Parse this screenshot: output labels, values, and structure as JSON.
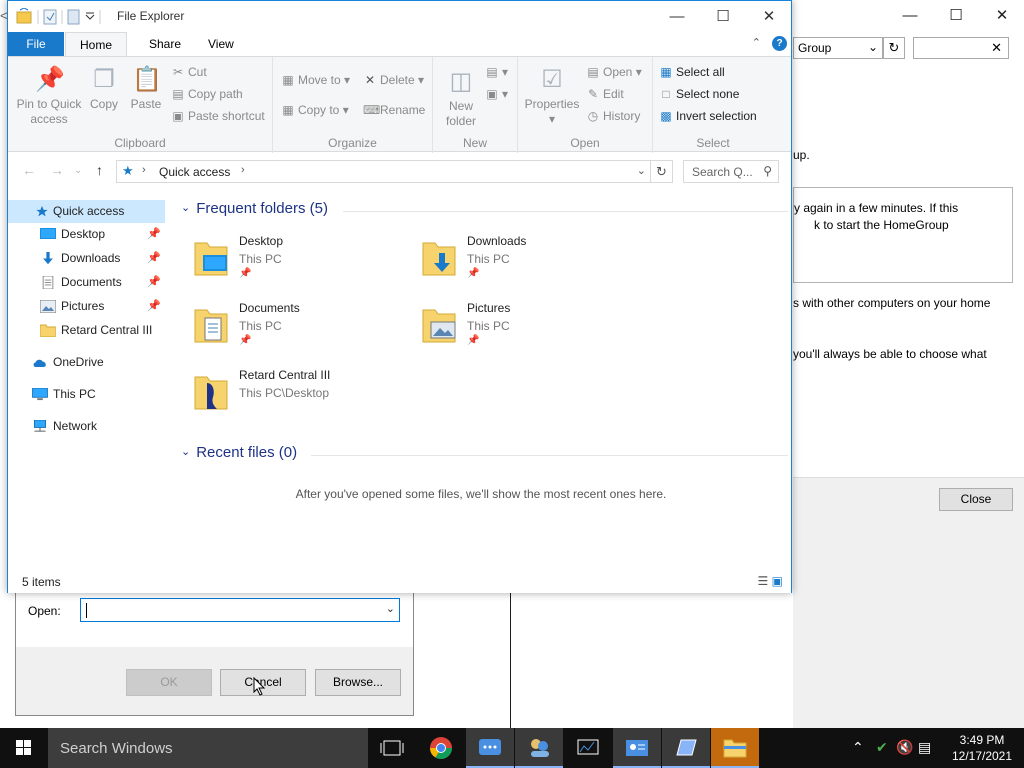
{
  "background_window": {
    "address_text": "Group",
    "info_line_1": "up.",
    "box_line_1": "y again in a few minutes. If this",
    "box_line_2": "k to start the HomeGroup",
    "info_line_2": "s with other computers on your home",
    "info_line_3": "you'll always be able to choose what",
    "close_label": "Close"
  },
  "run_dialog": {
    "open_label": "Open:",
    "open_value": "",
    "ok_label": "OK",
    "cancel_label": "Cancel",
    "browse_label": "Browse..."
  },
  "explorer": {
    "title": "File Explorer",
    "tabs": [
      {
        "label": "File"
      },
      {
        "label": "Home"
      },
      {
        "label": "Share"
      },
      {
        "label": "View"
      }
    ],
    "ribbon": {
      "clipboard": {
        "label": "Clipboard",
        "pin_label_1": "Pin to Quick",
        "pin_label_2": "access",
        "copy": "Copy",
        "paste": "Paste",
        "cut": "Cut",
        "copy_path": "Copy path",
        "paste_shortcut": "Paste shortcut"
      },
      "organize": {
        "label": "Organize",
        "move_to": "Move to",
        "copy_to": "Copy to",
        "delete": "Delete",
        "rename": "Rename"
      },
      "new": {
        "label": "New",
        "new_folder_1": "New",
        "new_folder_2": "folder"
      },
      "open": {
        "label": "Open",
        "properties": "Properties",
        "open": "Open",
        "edit": "Edit",
        "history": "History"
      },
      "select": {
        "label": "Select",
        "select_all": "Select all",
        "select_none": "Select none",
        "invert_selection": "Invert selection"
      }
    },
    "address": {
      "crumb": "Quick access",
      "search_placeholder": "Search Q..."
    },
    "nav": [
      {
        "label": "Quick access"
      },
      {
        "label": "Desktop"
      },
      {
        "label": "Downloads"
      },
      {
        "label": "Documents"
      },
      {
        "label": "Pictures"
      },
      {
        "label": "Retard Central III"
      },
      {
        "label": "OneDrive"
      },
      {
        "label": "This PC"
      },
      {
        "label": "Network"
      }
    ],
    "frequent_header": "Frequent folders (5)",
    "folders": [
      {
        "name": "Desktop",
        "location": "This PC"
      },
      {
        "name": "Downloads",
        "location": "This PC"
      },
      {
        "name": "Documents",
        "location": "This PC"
      },
      {
        "name": "Pictures",
        "location": "This PC"
      },
      {
        "name": "Retard Central III",
        "location": "This PC\\Desktop"
      }
    ],
    "recent_header": "Recent files (0)",
    "recent_empty": "After you've opened some files, we'll show the most recent ones here.",
    "status_count": "5 items"
  },
  "taskbar": {
    "search_placeholder": "Search Windows",
    "time": "3:49 PM",
    "date": "12/17/2021"
  },
  "colors": {
    "accent": "#1979ca",
    "selection": "#cce8ff",
    "taskbar": "#101010",
    "section_header": "#1e3287"
  }
}
